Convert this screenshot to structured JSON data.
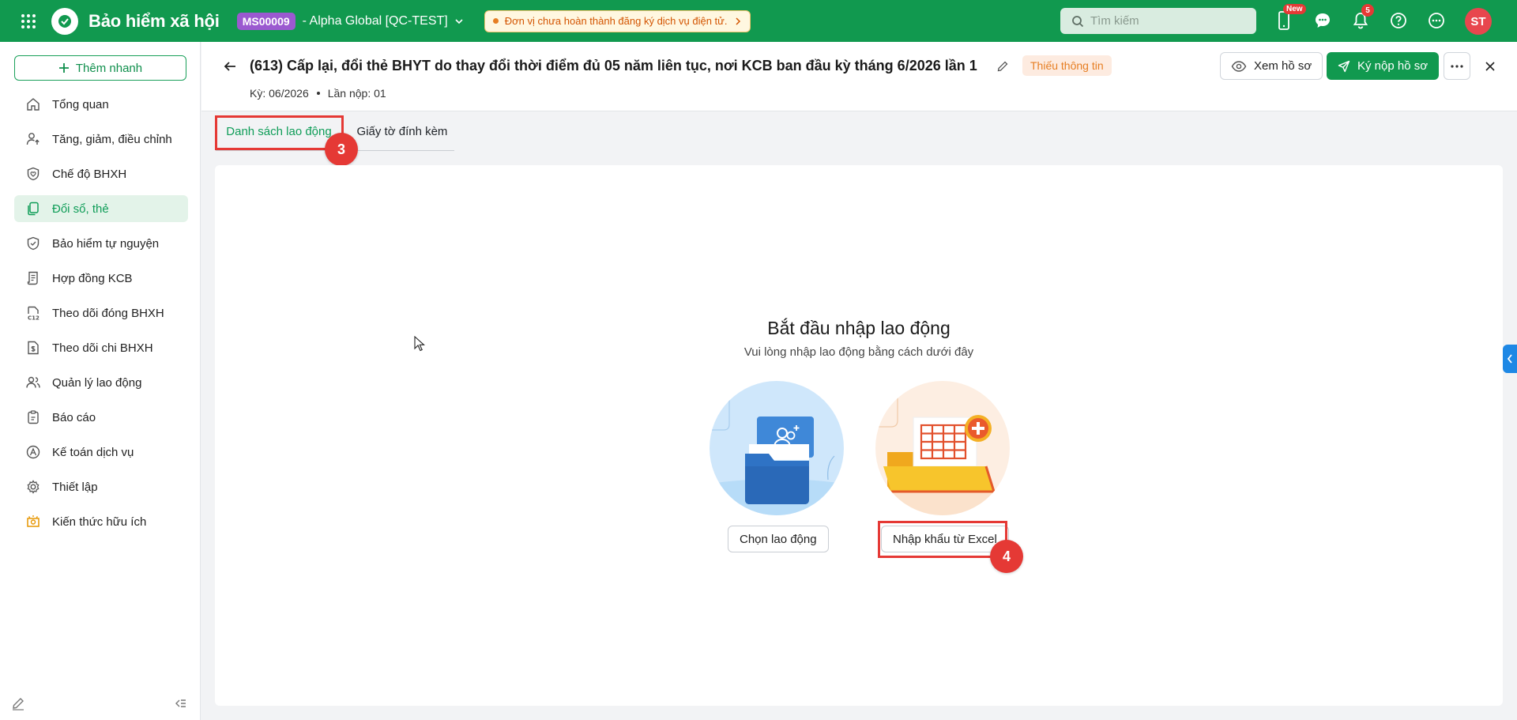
{
  "topbar": {
    "app_title": "Bảo hiểm xã hội",
    "org_code": "MS00009",
    "org_name": "- Alpha Global [QC-TEST]",
    "warning": "Đơn vị chưa hoàn thành đăng ký dịch vụ điện tử.",
    "search_placeholder": "Tìm kiếm",
    "new_badge": "New",
    "notification_count": "5",
    "avatar_initials": "ST"
  },
  "sidebar": {
    "quick_add": "Thêm nhanh",
    "items": [
      {
        "label": "Tổng quan",
        "icon": "home-icon"
      },
      {
        "label": "Tăng, giảm, điều chỉnh",
        "icon": "user-up-icon"
      },
      {
        "label": "Chế độ BHXH",
        "icon": "heart-shield-icon"
      },
      {
        "label": "Đổi sổ, thẻ",
        "icon": "card-copy-icon",
        "active": true
      },
      {
        "label": "Bảo hiểm tự nguyện",
        "icon": "shield-icon"
      },
      {
        "label": "Hợp đồng KCB",
        "icon": "contract-icon"
      },
      {
        "label": "Theo dõi đóng BHXH",
        "icon": "c12-doc-icon"
      },
      {
        "label": "Theo dõi chi BHXH",
        "icon": "money-doc-icon"
      },
      {
        "label": "Quản lý lao động",
        "icon": "users-icon"
      },
      {
        "label": "Báo cáo",
        "icon": "clipboard-icon"
      },
      {
        "label": "Kế toán dịch vụ",
        "icon": "accounting-icon"
      },
      {
        "label": "Thiết lập",
        "icon": "gear-icon"
      },
      {
        "label": "Kiến thức hữu ích",
        "icon": "knowledge-icon"
      }
    ]
  },
  "header": {
    "title": "(613) Cấp lại, đổi thẻ BHYT do thay đổi thời điểm đủ 05 năm liên tục, nơi KCB ban đầu kỳ tháng 6/2026 lần 1",
    "status": "Thiếu thông tin",
    "period": "Kỳ: 06/2026",
    "submission": "Lần nộp: 01",
    "view_button": "Xem hồ sơ",
    "submit_button": "Ký nộp hồ sơ"
  },
  "tabs": [
    {
      "label": "Danh sách lao động",
      "active": true
    },
    {
      "label": "Giấy tờ đính kèm",
      "active": false
    }
  ],
  "steps": {
    "tab_step": "3",
    "import_step": "4"
  },
  "empty_state": {
    "title": "Bắt đầu nhập lao động",
    "subtitle": "Vui lòng nhập lao động bằng cách dưới đây",
    "choose_button": "Chọn lao động",
    "import_button": "Nhập khẩu từ Excel"
  },
  "colors": {
    "brand": "#11994f",
    "accent_red": "#e53935",
    "warning": "#e67e22"
  }
}
